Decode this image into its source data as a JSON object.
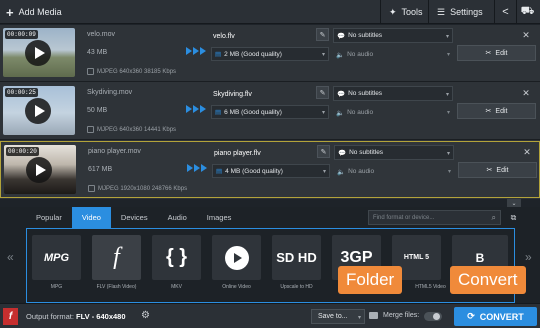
{
  "toolbar": {
    "add_media": "Add Media",
    "tools": "Tools",
    "settings": "Settings"
  },
  "files": [
    {
      "time": "00:00:09",
      "name": "velo.mov",
      "size": "43 MB",
      "info": "MJPEG 640x360 38185 Kbps",
      "output_name": "velo.flv",
      "quality": "2 MB (Good quality)",
      "subtitles": "No subtitles",
      "audio": "No audio",
      "edit": "Edit",
      "selected": false
    },
    {
      "time": "00:00:25",
      "name": "Skydiving.mov",
      "size": "50 MB",
      "info": "MJPEG 640x360 14441 Kbps",
      "output_name": "Skydiving.flv",
      "quality": "6 MB (Good quality)",
      "subtitles": "No subtitles",
      "audio": "No audio",
      "edit": "Edit",
      "selected": false
    },
    {
      "time": "00:00:20",
      "name": "piano player.mov",
      "size": "617 MB",
      "info": "MJPEG 1920x1080 248766 Kbps",
      "output_name": "piano player.flv",
      "quality": "4 MB (Good quality)",
      "subtitles": "No subtitles",
      "audio": "No audio",
      "edit": "Edit",
      "selected": true
    }
  ],
  "tabs": [
    "Popular",
    "Video",
    "Devices",
    "Audio",
    "Images"
  ],
  "active_tab": "Video",
  "search_placeholder": "Find format or device...",
  "formats": [
    {
      "label": "MPG"
    },
    {
      "label": "FLV (Flash Video)"
    },
    {
      "label": "MKV"
    },
    {
      "label": "Online Video"
    },
    {
      "label": "Upscale to HD"
    },
    {
      "label": "3GP"
    },
    {
      "label": "HTML5 Video"
    },
    {
      "label": "Blu-ray"
    }
  ],
  "callouts": {
    "folder": "Folder",
    "convert": "Convert"
  },
  "bottom": {
    "output_label": "Output format:",
    "output_value": "FLV - 640x480",
    "save_to": "Save to...",
    "merge": "Merge files:",
    "convert": "CONVERT"
  },
  "colors": {
    "accent": "#2b8ee0",
    "callout": "#f08a3a",
    "selected_border": "#b3a33a"
  }
}
